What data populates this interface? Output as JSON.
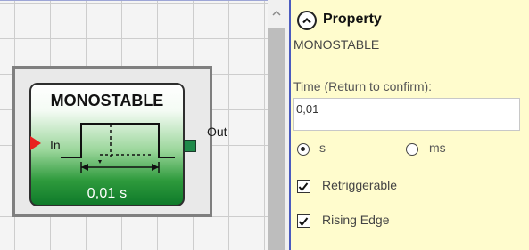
{
  "block": {
    "title": "MONOSTABLE",
    "time_value": "0,01 s",
    "input_label": "In",
    "output_label": "Out"
  },
  "panel": {
    "title": "Property",
    "subtitle": "MONOSTABLE",
    "time_label": "Time (Return to confirm):",
    "time_value": "0,01",
    "unit_options": [
      {
        "label": "s",
        "selected": true
      },
      {
        "label": "ms",
        "selected": false
      }
    ],
    "checkboxes": [
      {
        "label": "Retriggerable",
        "checked": true
      },
      {
        "label": "Rising Edge",
        "checked": true
      }
    ]
  },
  "colors": {
    "panel_background": "#fffccd",
    "block_gradient_bottom": "#0f7a2a",
    "input_arrow": "#e8211f",
    "output_port": "#1f8a4a",
    "divider": "#4b5bbf"
  },
  "icons": {
    "collapse": "chevron-up-circle-icon",
    "scroll_up": "scroll-up-arrow-icon"
  }
}
